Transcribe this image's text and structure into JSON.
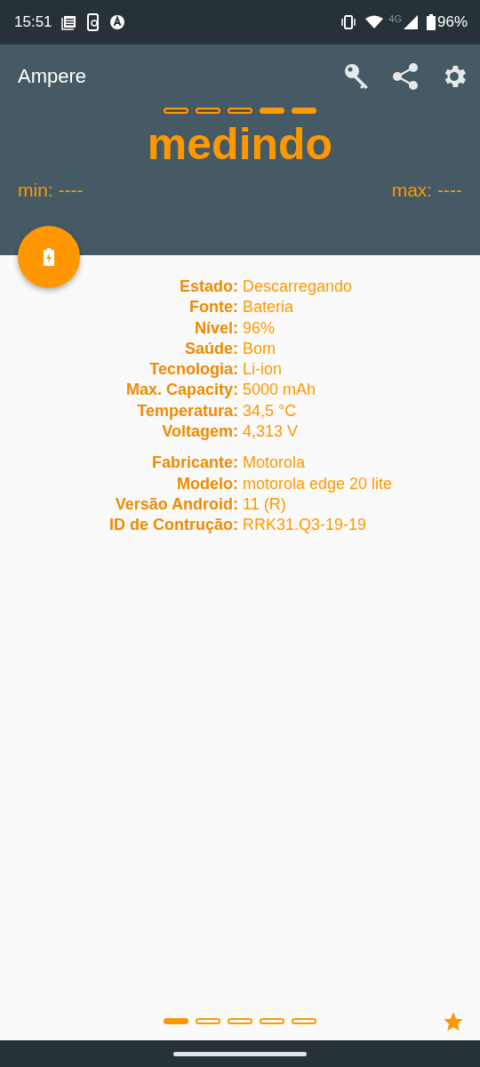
{
  "status_bar": {
    "time": "15:51",
    "network": "4G",
    "battery": "96%"
  },
  "app_bar": {
    "title": "Ampere"
  },
  "meter": {
    "segments": [
      {
        "filled": false
      },
      {
        "filled": false
      },
      {
        "filled": false
      },
      {
        "filled": true
      },
      {
        "filled": true
      }
    ],
    "reading": "medindo",
    "min": "min: ----",
    "max": "max: ----"
  },
  "info_groups": [
    {
      "rows": [
        {
          "label": "Estado:",
          "value": "Descarregando"
        },
        {
          "label": "Fonte:",
          "value": "Bateria"
        },
        {
          "label": "Nível:",
          "value": "96%"
        },
        {
          "label": "Saúde:",
          "value": "Bom"
        },
        {
          "label": "Tecnologia:",
          "value": "Li-ion"
        },
        {
          "label": "Max. Capacity:",
          "value": "5000 mAh"
        },
        {
          "label": "Temperatura:",
          "value": "34,5 °C"
        },
        {
          "label": "Voltagem:",
          "value": "4,313 V"
        }
      ]
    },
    {
      "rows": [
        {
          "label": "Fabricante:",
          "value": "Motorola"
        },
        {
          "label": "Modelo:",
          "value": "motorola edge 20 lite"
        },
        {
          "label": "Versão Android:",
          "value": "11 (R)"
        },
        {
          "label": "ID de Contrução:",
          "value": "RRK31.Q3-19-19"
        }
      ]
    }
  ],
  "pager": [
    {
      "selected": true
    },
    {
      "selected": false
    },
    {
      "selected": false
    },
    {
      "selected": false
    },
    {
      "selected": false
    }
  ]
}
